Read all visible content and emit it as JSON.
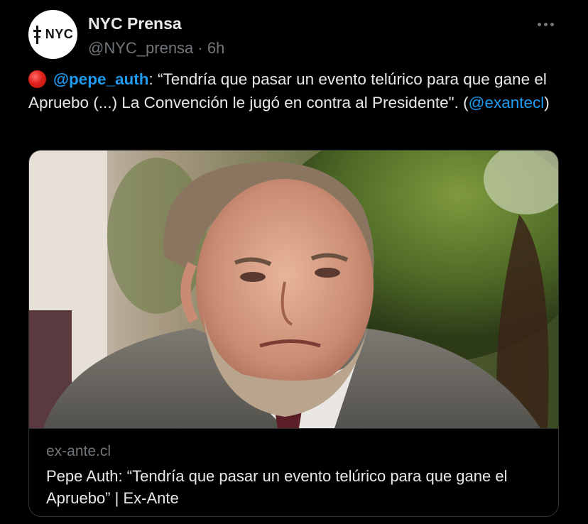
{
  "author": {
    "avatar_label": "NYC",
    "display_name": "NYC Prensa",
    "handle": "@NYC_prensa",
    "separator": "·",
    "time": "6h"
  },
  "tweet": {
    "mention_1": "@pepe_auth",
    "text_1": ": “Tendría que pasar un evento telúrico para que gane el Apruebo (...) La Convención le jugó en contra al Presidente\". (",
    "mention_2": "@exantecl",
    "text_2": ")"
  },
  "card": {
    "domain": "ex-ante.cl",
    "title": "Pepe Auth: “Tendría que pasar un evento telúrico para que gane el Apruebo” | Ex-Ante"
  },
  "icons": {
    "status": "red-circle-emoji-icon",
    "more": "more-options-icon"
  },
  "colors": {
    "background": "#000000",
    "link": "#1d9bf0",
    "text": "#e7e9ea",
    "muted": "#71767b",
    "border": "#2f3336"
  }
}
